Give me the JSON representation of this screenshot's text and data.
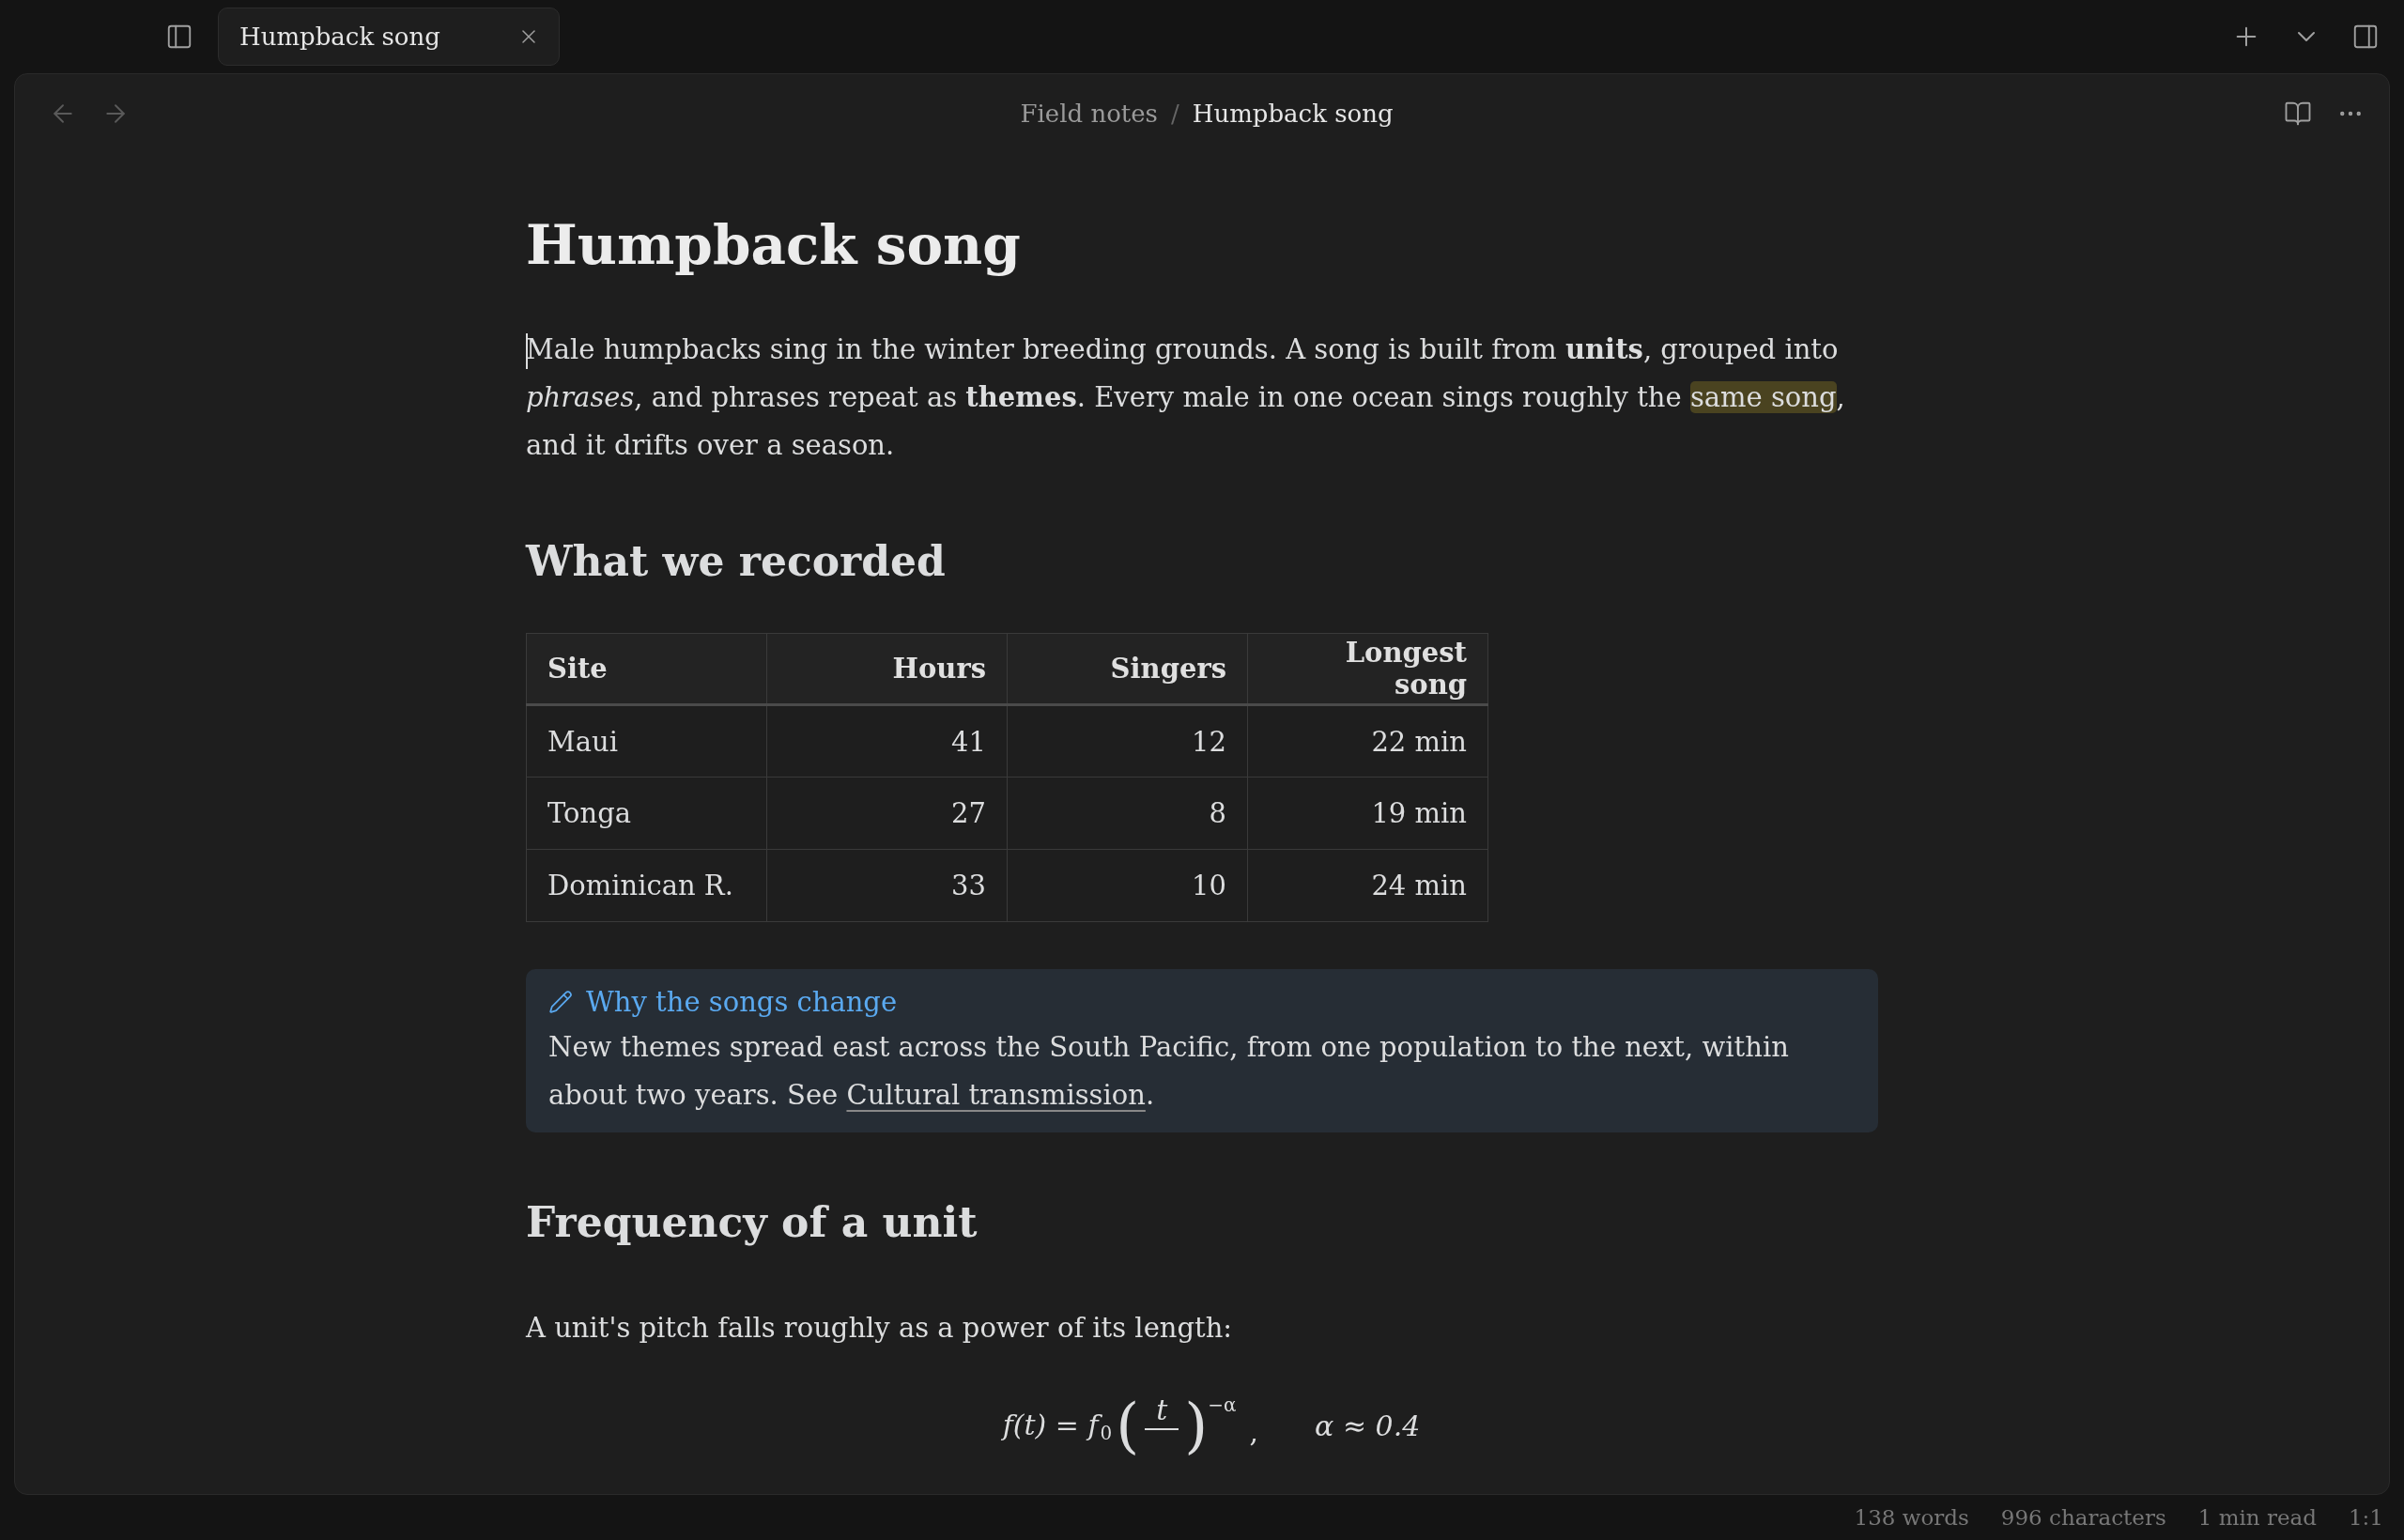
{
  "tabs": [
    {
      "label": "Humpback song",
      "selected": true
    }
  ],
  "breadcrumb": {
    "separator": "/",
    "items": [
      {
        "label": "Field notes",
        "current": false
      },
      {
        "label": "Humpback song",
        "current": true
      }
    ]
  },
  "title": "Humpback song",
  "intro": [
    {
      "text": "Male humpbacks sing in the winter breeding grounds. A song is built from **units**, grouped into *phrases*, and phrases repeat as **themes**. Every male in one ocean sings roughly the ",
      "highlight": false
    },
    {
      "text": "same song",
      "highlight": true
    },
    {
      "text": ", and it drifts over a season.",
      "highlight": false
    }
  ],
  "section_1": {
    "heading": "What we recorded"
  },
  "table": {
    "columns": [
      {
        "label": "Site",
        "kind": "text"
      },
      {
        "label": "Hours",
        "kind": "number"
      },
      {
        "label": "Singers",
        "kind": "number"
      },
      {
        "label": "Longest song",
        "kind": "number"
      }
    ],
    "rows": [
      [
        "Maui",
        "41",
        "12",
        "22 min"
      ],
      [
        "Tonga",
        "27",
        "8",
        "19 min"
      ],
      [
        "Dominican R.",
        "33",
        "10",
        "24 min"
      ]
    ]
  },
  "callout": {
    "title": "Why the songs change",
    "text_before": "New themes spread east across the South Pacific, from one population to the next, within about two years. See ",
    "link": "Cultural transmission",
    "text_after": "."
  },
  "section_2": {
    "heading": "Frequency of a unit",
    "text": "A unit's pitch falls roughly as a power of its length:"
  },
  "formula": {
    "function": "f(t) = f",
    "subscript": "0",
    "left_paren": "(",
    "numerator": "t",
    "right_paren": ")",
    "exponent": "−α",
    "separator": ",",
    "condition": "α ≈ 0.4"
  },
  "status_bar": [
    "138 words",
    "996 characters",
    "1 min read",
    "1:1"
  ]
}
